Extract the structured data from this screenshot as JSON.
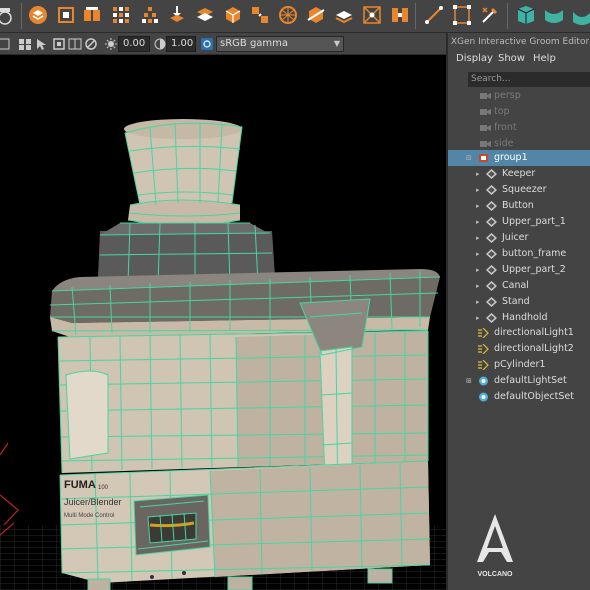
{
  "viewport": {
    "toolbar": {
      "exposure_value": "0.00",
      "gamma_value": "1.00",
      "color_space": "sRGB gamma"
    },
    "product_labels": {
      "brand": "FUMA",
      "brand_suffix": "100",
      "line1": "Juicer/Blender",
      "line2": "Multi Mode Control"
    }
  },
  "outliner": {
    "title": "XGen Interactive Groom Editor",
    "menu": [
      "Display",
      "Show",
      "Help"
    ],
    "search_placeholder": "Search...",
    "cameras": [
      "persp",
      "top",
      "front",
      "side"
    ],
    "group": {
      "label": "group1",
      "expanded": true,
      "selected": true
    },
    "children": [
      "Keeper",
      "Squeezer",
      "Button",
      "Upper_part_1",
      "Juicer",
      "button_frame",
      "Upper_part_2",
      "Canal",
      "Stand",
      "Handhold"
    ],
    "after_group": [
      {
        "label": "directionalLight1",
        "icon": "light-icon"
      },
      {
        "label": "directionalLight2",
        "icon": "light-icon"
      },
      {
        "label": "pCylinder1",
        "icon": "light-icon"
      },
      {
        "label": "defaultLightSet",
        "icon": "set-icon",
        "expandable": true
      },
      {
        "label": "defaultObjectSet",
        "icon": "set-icon",
        "expandable": false
      }
    ]
  },
  "watermark": {
    "text": "VOLCANO"
  },
  "colors": {
    "wire": "#46d6a0",
    "selection": "#5285a6",
    "panel": "#444444",
    "body": "#d2c6b6"
  }
}
